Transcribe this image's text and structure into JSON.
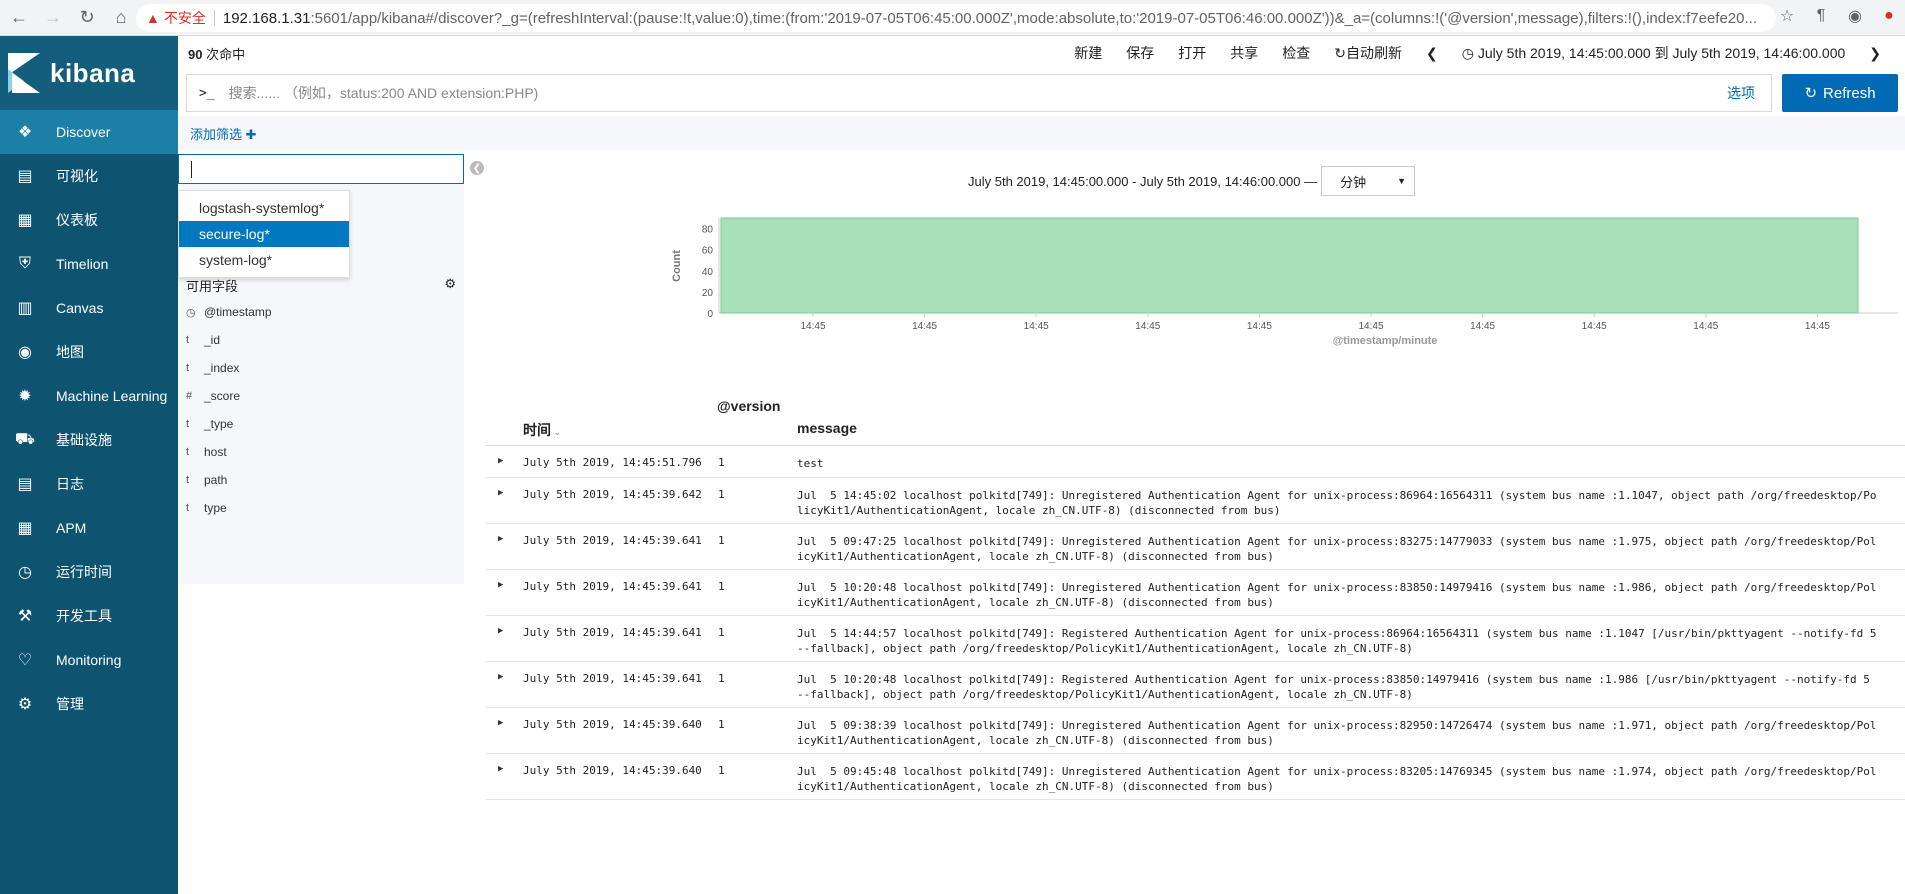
{
  "browser": {
    "insecure_label": "不安全",
    "url_host": "192.168.1.31",
    "url_rest": ":5601/app/kibana#/discover?_g=(refreshInterval:(pause:!t,value:0),time:(from:'2019-07-05T06:45:00.000Z',mode:absolute,to:'2019-07-05T06:46:00.000Z'))&_a=(columns:!('@version',message),filters:!(),index:f7eefe20..."
  },
  "sidebar": {
    "brand": "kibana",
    "items": [
      {
        "label": "Discover",
        "icon": "compass-icon"
      },
      {
        "label": "可视化",
        "icon": "chart-icon"
      },
      {
        "label": "仪表板",
        "icon": "dashboard-icon"
      },
      {
        "label": "Timelion",
        "icon": "shield-icon"
      },
      {
        "label": "Canvas",
        "icon": "canvas-icon"
      },
      {
        "label": "地图",
        "icon": "map-icon"
      },
      {
        "label": "Machine Learning",
        "icon": "ml-icon"
      },
      {
        "label": "基础设施",
        "icon": "infra-icon"
      },
      {
        "label": "日志",
        "icon": "logs-icon"
      },
      {
        "label": "APM",
        "icon": "apm-icon"
      },
      {
        "label": "运行时间",
        "icon": "uptime-icon"
      },
      {
        "label": "开发工具",
        "icon": "wrench-icon"
      },
      {
        "label": "Monitoring",
        "icon": "heartbeat-icon"
      },
      {
        "label": "管理",
        "icon": "gear-icon"
      }
    ]
  },
  "topnav": {
    "hits_count": "90",
    "hits_label": " 次命中",
    "links": [
      "新建",
      "保存",
      "打开",
      "共享",
      "检查"
    ],
    "auto_refresh": "自动刷新",
    "time_range": "July 5th 2019, 14:45:00.000 到 July 5th 2019, 14:46:00.000"
  },
  "query": {
    "prompt": ">_",
    "placeholder": "搜索...... （例如，status:200 AND extension:PHP)",
    "options": "选项",
    "refresh": "Refresh"
  },
  "filter": {
    "add": "添加筛选 ✚"
  },
  "index_dropdown": {
    "options": [
      "logstash-systemlog*",
      "secure-log*",
      "system-log*"
    ],
    "selected_index": 1
  },
  "fields": {
    "header": "可用字段",
    "items": [
      {
        "type": "◷",
        "name": "@timestamp"
      },
      {
        "type": "t",
        "name": "_id"
      },
      {
        "type": "t",
        "name": "_index"
      },
      {
        "type": "#",
        "name": "_score"
      },
      {
        "type": "t",
        "name": "_type"
      },
      {
        "type": "t",
        "name": "host"
      },
      {
        "type": "t",
        "name": "path"
      },
      {
        "type": "t",
        "name": "type"
      }
    ]
  },
  "chart": {
    "range_label": "July 5th 2019, 14:45:00.000 - July 5th 2019, 14:46:00.000 —",
    "interval": "分钟"
  },
  "chart_data": {
    "type": "bar",
    "categories": [
      "14:45"
    ],
    "values": [
      90
    ],
    "xlabel": "@timestamp/minute",
    "ylabel": "Count",
    "ylim": [
      0,
      90
    ],
    "yticks": [
      0,
      20,
      40,
      60,
      80
    ],
    "xticks": [
      "14:45",
      "14:45",
      "14:45",
      "14:45",
      "14:45",
      "14:45",
      "14:45",
      "14:45",
      "14:45",
      "14:45",
      "14:45"
    ],
    "bar_color": "#a8e0b7"
  },
  "table": {
    "headers": {
      "time": "时间",
      "version": "@version",
      "message": "message"
    },
    "rows": [
      {
        "time": "July 5th 2019, 14:45:51.796",
        "version": "1",
        "message": "test"
      },
      {
        "time": "July 5th 2019, 14:45:39.642",
        "version": "1",
        "message": "Jul  5 14:45:02 localhost polkitd[749]: Unregistered Authentication Agent for unix-process:86964:16564311 (system bus name :1.1047, object path /org/freedesktop/PolicyKit1/AuthenticationAgent, locale zh_CN.UTF-8) (disconnected from bus)"
      },
      {
        "time": "July 5th 2019, 14:45:39.641",
        "version": "1",
        "message": "Jul  5 09:47:25 localhost polkitd[749]: Unregistered Authentication Agent for unix-process:83275:14779033 (system bus name :1.975, object path /org/freedesktop/PolicyKit1/AuthenticationAgent, locale zh_CN.UTF-8) (disconnected from bus)"
      },
      {
        "time": "July 5th 2019, 14:45:39.641",
        "version": "1",
        "message": "Jul  5 10:20:48 localhost polkitd[749]: Unregistered Authentication Agent for unix-process:83850:14979416 (system bus name :1.986, object path /org/freedesktop/PolicyKit1/AuthenticationAgent, locale zh_CN.UTF-8) (disconnected from bus)"
      },
      {
        "time": "July 5th 2019, 14:45:39.641",
        "version": "1",
        "message": "Jul  5 14:44:57 localhost polkitd[749]: Registered Authentication Agent for unix-process:86964:16564311 (system bus name :1.1047 [/usr/bin/pkttyagent --notify-fd 5 --fallback], object path /org/freedesktop/PolicyKit1/AuthenticationAgent, locale zh_CN.UTF-8)"
      },
      {
        "time": "July 5th 2019, 14:45:39.641",
        "version": "1",
        "message": "Jul  5 10:20:48 localhost polkitd[749]: Registered Authentication Agent for unix-process:83850:14979416 (system bus name :1.986 [/usr/bin/pkttyagent --notify-fd 5 --fallback], object path /org/freedesktop/PolicyKit1/AuthenticationAgent, locale zh_CN.UTF-8)"
      },
      {
        "time": "July 5th 2019, 14:45:39.640",
        "version": "1",
        "message": "Jul  5 09:38:39 localhost polkitd[749]: Unregistered Authentication Agent for unix-process:82950:14726474 (system bus name :1.971, object path /org/freedesktop/PolicyKit1/AuthenticationAgent, locale zh_CN.UTF-8) (disconnected from bus)"
      },
      {
        "time": "July 5th 2019, 14:45:39.640",
        "version": "1",
        "message": "Jul  5 09:45:48 localhost polkitd[749]: Unregistered Authentication Agent for unix-process:83205:14769345 (system bus name :1.974, object path /org/freedesktop/PolicyKit1/AuthenticationAgent, locale zh_CN.UTF-8) (disconnected from bus)"
      }
    ]
  }
}
